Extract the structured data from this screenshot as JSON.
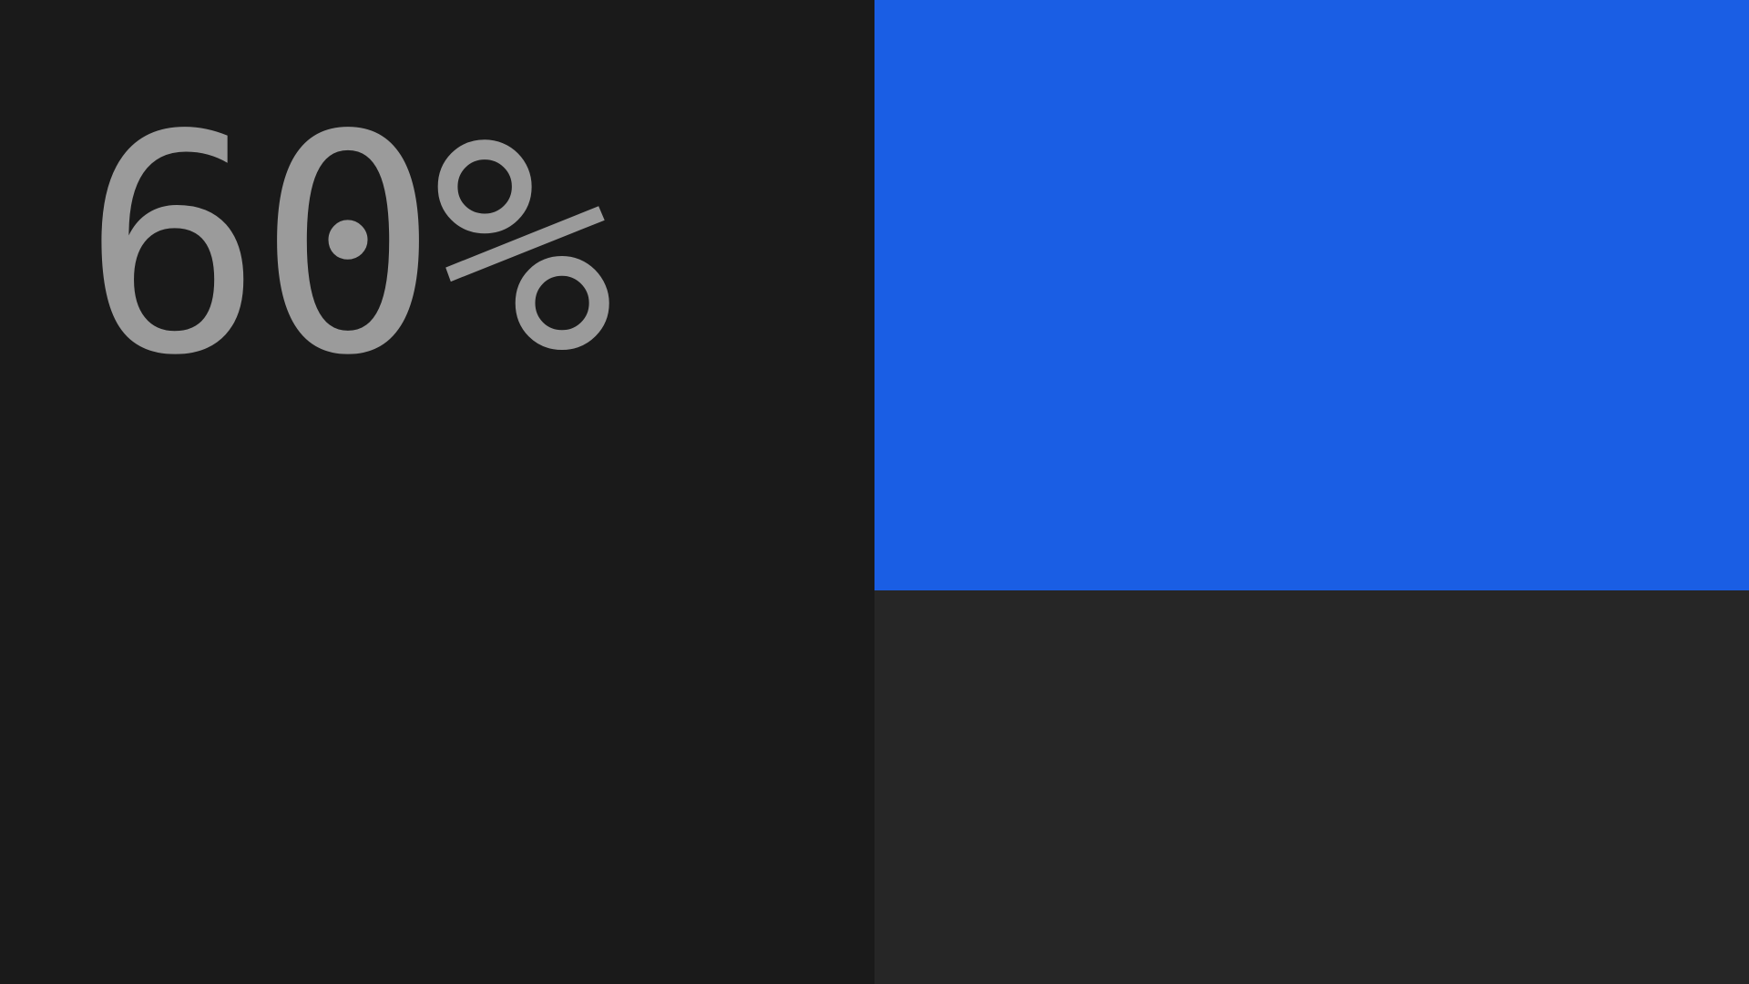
{
  "readout": {
    "label": "60%"
  },
  "level": {
    "fraction": 0.6
  },
  "colors": {
    "background": "#1a1a1a",
    "text": "#9b9b9b",
    "fill": "#1a5ee4",
    "track": "#262626"
  }
}
